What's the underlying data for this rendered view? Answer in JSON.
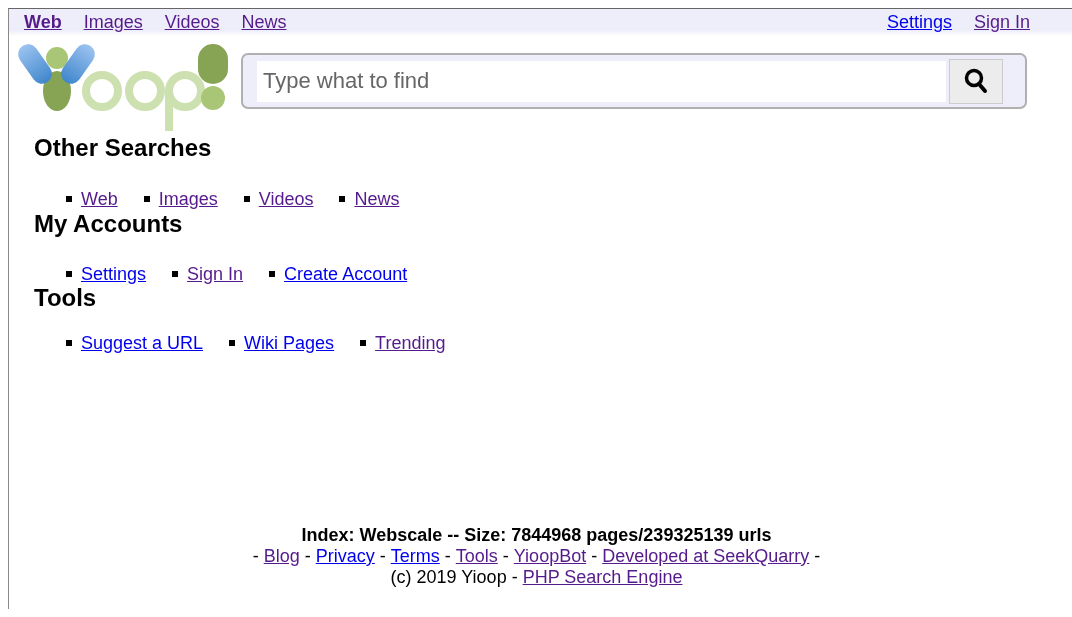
{
  "top_nav": {
    "left": [
      {
        "label": "Web",
        "selected": true,
        "visited": true
      },
      {
        "label": "Images",
        "selected": false,
        "visited": true
      },
      {
        "label": "Videos",
        "selected": false,
        "visited": true
      },
      {
        "label": "News",
        "selected": false,
        "visited": true
      }
    ],
    "right": [
      {
        "label": "Settings",
        "visited": false
      },
      {
        "label": "Sign In",
        "visited": true
      }
    ]
  },
  "search": {
    "placeholder": "Type what to find"
  },
  "sections": [
    {
      "title": "Other Searches",
      "links": [
        {
          "label": "Web",
          "visited": true
        },
        {
          "label": "Images",
          "visited": true
        },
        {
          "label": "Videos",
          "visited": true
        },
        {
          "label": "News",
          "visited": true
        }
      ]
    },
    {
      "title": "My Accounts",
      "links": [
        {
          "label": "Settings",
          "visited": false
        },
        {
          "label": "Sign In",
          "visited": true
        },
        {
          "label": "Create Account",
          "visited": false
        }
      ]
    },
    {
      "title": "Tools",
      "links": [
        {
          "label": "Suggest a URL",
          "visited": false
        },
        {
          "label": "Wiki Pages",
          "visited": false
        },
        {
          "label": "Trending",
          "visited": true
        }
      ]
    }
  ],
  "footer": {
    "index_info": "Index: Webscale -- Size: 7844968 pages/239325139 urls",
    "links": [
      {
        "label": "Blog",
        "visited": true
      },
      {
        "label": "Privacy",
        "visited": false
      },
      {
        "label": "Terms",
        "visited": false
      },
      {
        "label": "Tools",
        "visited": true
      },
      {
        "label": "YioopBot",
        "visited": true
      },
      {
        "label": "Developed at SeekQuarry",
        "visited": true
      }
    ],
    "separator": "-",
    "copyright": "(c) 2019 Yioop -",
    "copyright_link": {
      "label": "PHP Search Engine",
      "visited": true
    }
  }
}
